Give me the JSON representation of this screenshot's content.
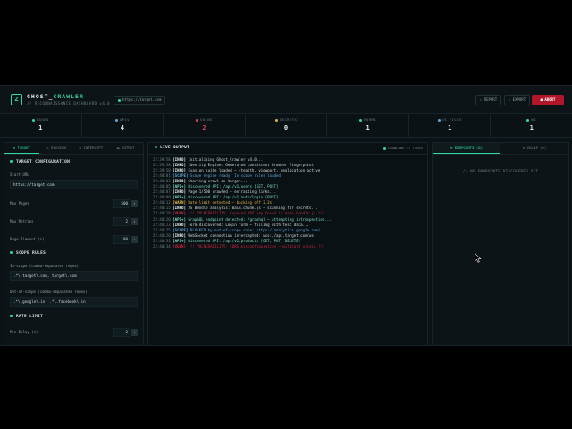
{
  "header": {
    "logo_glyph": "Z",
    "title_a": "GHOST_",
    "title_b": "CRAWLER",
    "subtitle": "// RECONNAISSANCE DASHBOARD v4.0",
    "target_url": "https://target.com",
    "report_label": "⇩ REPORT",
    "export_label": "⇩ EXPORT",
    "abort_label": "■ ABORT"
  },
  "stats": [
    {
      "label": "PAGES",
      "value": "1",
      "color": "#34d6a6"
    },
    {
      "label": "APIs",
      "value": "4",
      "color": "#5fa9de"
    },
    {
      "label": "VULNS",
      "value": "2",
      "color": "#e0475a",
      "alert": true
    },
    {
      "label": "SECRETS",
      "value": "0",
      "color": "#e0b44a"
    },
    {
      "label": "FORMS",
      "value": "1",
      "color": "#34d6a6"
    },
    {
      "label": "JS FILES",
      "value": "1",
      "color": "#5fa9de"
    },
    {
      "label": "WS",
      "value": "1",
      "color": "#34d6a6"
    }
  ],
  "left_panel": {
    "tabs": [
      "⊕ TARGET",
      "◇ EVASION",
      "⊞ INTERCEPT",
      "⧉ OUTPUT"
    ],
    "target_section": "TARGET CONFIGURATION",
    "start_url_label": "Start URL",
    "start_url_value": "https://target.com",
    "max_pages_label": "Max Pages",
    "max_pages_value": "500",
    "max_retries_label": "Max Retries",
    "max_retries_value": "2",
    "page_timeout_label": "Page Timeout (s)",
    "page_timeout_value": "180",
    "scope_section": "SCOPE RULES",
    "in_scope_label": "In-scope (comma-separated regex)",
    "in_scope_value": ".*\\.target\\.com, target\\.com",
    "out_scope_label": "Out-of-scope (comma-separated regex)",
    "out_scope_value": ".*\\.google\\.in, .*\\.facebook\\.in",
    "rate_section": "RATE LIMIT",
    "min_delay_label": "Min Delay (s)",
    "min_delay_value": "2",
    "stepper": "⇕"
  },
  "live_output": {
    "title": "LIVE OUTPUT",
    "status": "CRAWLING 17 lines",
    "lines": [
      {
        "ts": "22:39:58",
        "tag": "[INFO]",
        "level": "INFO",
        "msg": "Initializing Ghost_Crawler v4.0..."
      },
      {
        "ts": "22:39:58",
        "tag": "[INFO]",
        "level": "INFO",
        "msg": "Identity Engine: Generated consistent browser fingerprint"
      },
      {
        "ts": "22:39:58",
        "tag": "[INFO]",
        "level": "INFO",
        "msg": "Evasion suite loaded — stealth, viewport, geolocation active"
      },
      {
        "ts": "22:40:01",
        "tag": "[SCOPE]",
        "level": "SCOPE",
        "msg": "Scope engine ready. In-scope rules loaded."
      },
      {
        "ts": "22:40:03",
        "tag": "[INFO]",
        "level": "INFO",
        "msg": "Starting crawl on target..."
      },
      {
        "ts": "22:40:05",
        "tag": "[API+]",
        "level": "API",
        "msg": "Discovered API: /api/v1/users [GET, POST]"
      },
      {
        "ts": "22:40:07",
        "tag": "[INFO]",
        "level": "INFO",
        "msg": "Page 1/500 crawled — extracting links..."
      },
      {
        "ts": "22:40:09",
        "tag": "[API+]",
        "level": "API",
        "msg": "Discovered API: /api/v1/auth/login [POST]"
      },
      {
        "ts": "22:40:12",
        "tag": "[WARN]",
        "level": "WARN",
        "msg": "Rate limit detected — backing off 2.3s"
      },
      {
        "ts": "22:40:15",
        "tag": "[INFO]",
        "level": "INFO",
        "msg": "JS Bundle analysis: main.chunk.js — scanning for secrets..."
      },
      {
        "ts": "22:40:18",
        "tag": "[VULN]",
        "level": "VULN",
        "msg": "!!! VULNERABILITY: Exposed API key found in main.bundle.js !!!"
      },
      {
        "ts": "22:40:20",
        "tag": "[API+]",
        "level": "API",
        "msg": "GraphQL endpoint detected: /graphql — attempting introspection..."
      },
      {
        "ts": "22:40:23",
        "tag": "[INFO]",
        "level": "INFO",
        "msg": "Form discovered: Login form — filling with test data..."
      },
      {
        "ts": "22:40:25",
        "tag": "[SCOPE]",
        "level": "SCOPE",
        "msg": "BLOCKED by out-of-scope rule: https://analytics.google.com/..."
      },
      {
        "ts": "22:40:28",
        "tag": "[INFO]",
        "level": "INFO",
        "msg": "WebSocket connection intercepted: wss://api.target.com/ws"
      },
      {
        "ts": "22:40:31",
        "tag": "[API+]",
        "level": "API",
        "msg": "Discovered API: /api/v2/products [GET, PUT, DELETE]"
      },
      {
        "ts": "22:40:34",
        "tag": "[VULN]",
        "level": "VULN",
        "msg": "!!! VULNERABILITY: CORS misconfiguration — wildcard origin !!!"
      }
    ]
  },
  "right_panel": {
    "tabs": [
      "⊕ ENDPOINTS (0)",
      "⊘ VULNS (0)"
    ],
    "empty_text": "// NO ENDPOINTS DISCOVERED YET"
  }
}
